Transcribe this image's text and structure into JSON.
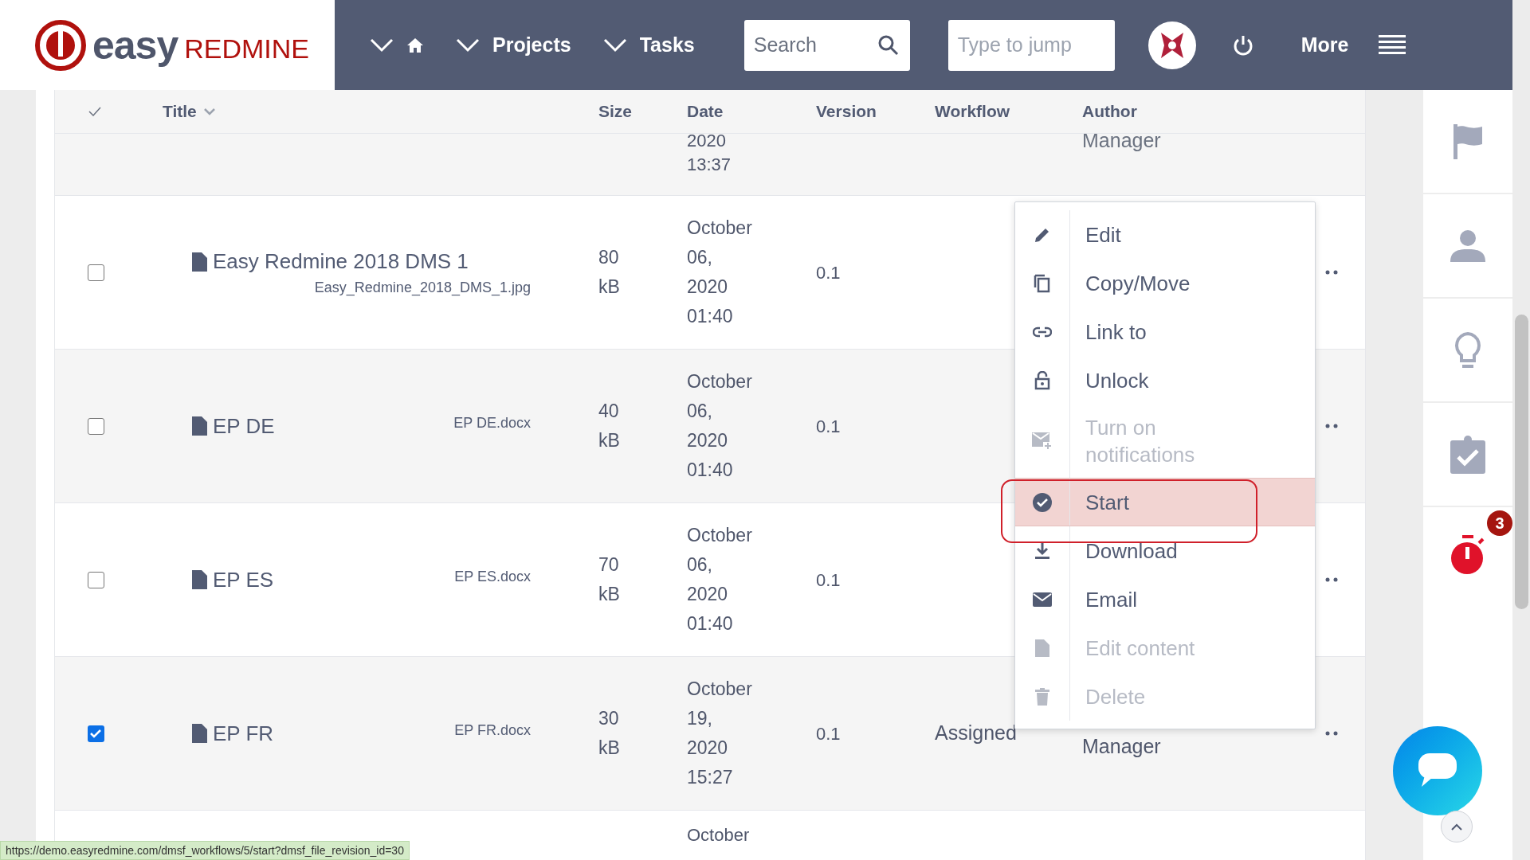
{
  "header": {
    "logo": {
      "word1": "easy",
      "word2": "REDMINE"
    },
    "nav": [
      {
        "kind": "home"
      },
      {
        "label": "Projects",
        "kind": "menu"
      },
      {
        "label": "Tasks",
        "kind": "menu"
      }
    ],
    "search": {
      "placeholder": "Search"
    },
    "jump": {
      "placeholder": "Type to jump"
    },
    "more": "More"
  },
  "table": {
    "columns": [
      "Title",
      "Size",
      "Date",
      "Version",
      "Workflow",
      "Author"
    ],
    "partial_row": {
      "date": "2020 13:37",
      "author": "Manager"
    },
    "rows": [
      {
        "checked": false,
        "title": "Easy Redmine 2018 DMS 1",
        "filename": "Easy_Redmine_2018_DMS_1.jpg",
        "size": "80 kB",
        "date": "October 06, 2020 01:40",
        "version": "0.1"
      },
      {
        "checked": false,
        "title": "EP DE",
        "filename": "EP DE.docx",
        "size": "40 kB",
        "date": "October 06, 2020 01:40",
        "version": "0.1"
      },
      {
        "checked": false,
        "title": "EP ES",
        "filename": "EP ES.docx",
        "size": "70 kB",
        "date": "October 06, 2020 01:40",
        "version": "0.1"
      },
      {
        "checked": true,
        "title": "EP FR",
        "filename": "EP FR.docx",
        "size": "30 kB",
        "date": "October 19, 2020 15:27",
        "version": "0.1",
        "workflow": "Assigned",
        "author": "Manager"
      }
    ],
    "bottom_row": {
      "date": "October"
    }
  },
  "context_menu": {
    "items": [
      {
        "label": "Edit",
        "disabled": false,
        "selected": false
      },
      {
        "label": "Copy/Move",
        "disabled": false,
        "selected": false
      },
      {
        "label": "Link to",
        "disabled": false,
        "selected": false
      },
      {
        "label": "Unlock",
        "disabled": false,
        "selected": false
      },
      {
        "label": "Turn on notifications",
        "disabled": true,
        "selected": false
      },
      {
        "label": "Start",
        "disabled": false,
        "selected": true
      },
      {
        "label": "Download",
        "disabled": false,
        "selected": false
      },
      {
        "label": "Email",
        "disabled": false,
        "selected": false
      },
      {
        "label": "Edit content",
        "disabled": true,
        "selected": false
      },
      {
        "label": "Delete",
        "disabled": true,
        "selected": false
      }
    ]
  },
  "sidebar": {
    "timer_badge": "3"
  },
  "status_bar": "https://demo.easyredmine.com/dmsf_workflows/5/start?dmsf_file_revision_id=30"
}
